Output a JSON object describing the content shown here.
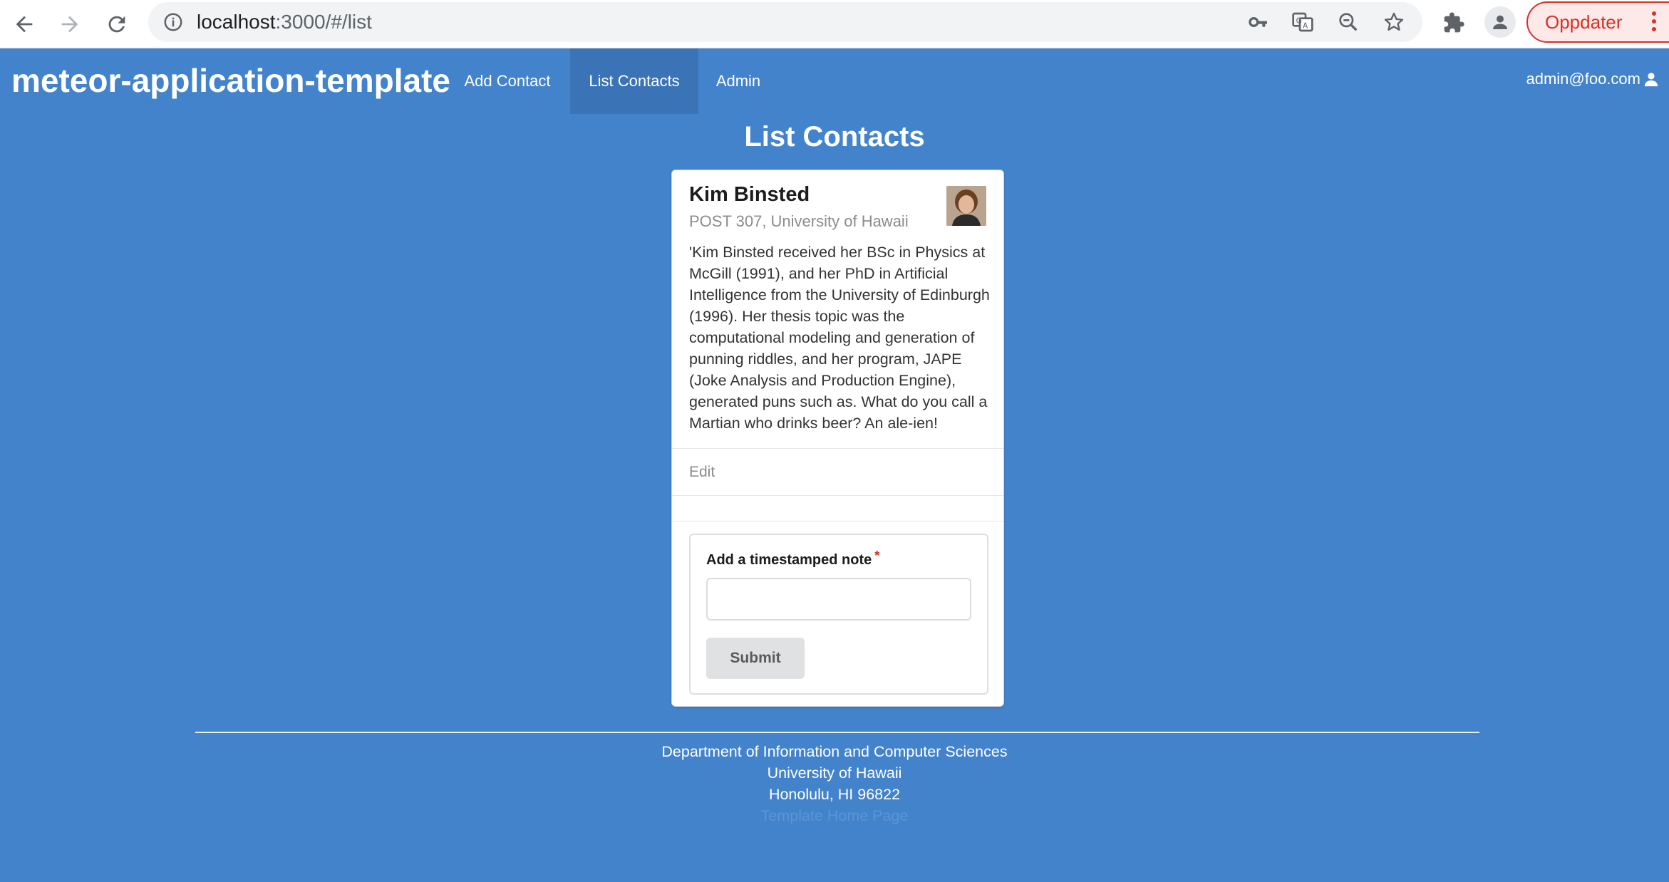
{
  "browser": {
    "url_host": "localhost",
    "url_rest": ":3000/#/list",
    "update_label": "Oppdater"
  },
  "navbar": {
    "brand": "meteor-application-template",
    "items": [
      {
        "label": "Add Contact",
        "active": false
      },
      {
        "label": "List Contacts",
        "active": true
      },
      {
        "label": "Admin",
        "active": false
      }
    ],
    "user": "admin@foo.com"
  },
  "page": {
    "title": "List Contacts"
  },
  "contact": {
    "name": "Kim Binsted",
    "address": "POST 307, University of Hawaii",
    "description": "'Kim Binsted received her BSc in Physics at McGill (1991), and her PhD in Artificial Intelligence from the University of Edinburgh (1996). Her thesis topic was the computational modeling and generation of punning riddles, and her program, JAPE (Joke Analysis and Production Engine), generated puns such as. What do you call a Martian who drinks beer? An ale-ien!",
    "edit_label": "Edit"
  },
  "note_form": {
    "label": "Add a timestamped note",
    "required_mark": "*",
    "value": "",
    "placeholder": "",
    "submit_label": "Submit"
  },
  "footer": {
    "line1": "Department of Information and Computer Sciences",
    "line2": "University of Hawaii",
    "line3": "Honolulu, HI 96822",
    "line4": "Template Home Page"
  },
  "colors": {
    "background": "#4383cc",
    "nav_active": "#3a74b7",
    "required": "#db2828",
    "update_red": "#d93025"
  }
}
